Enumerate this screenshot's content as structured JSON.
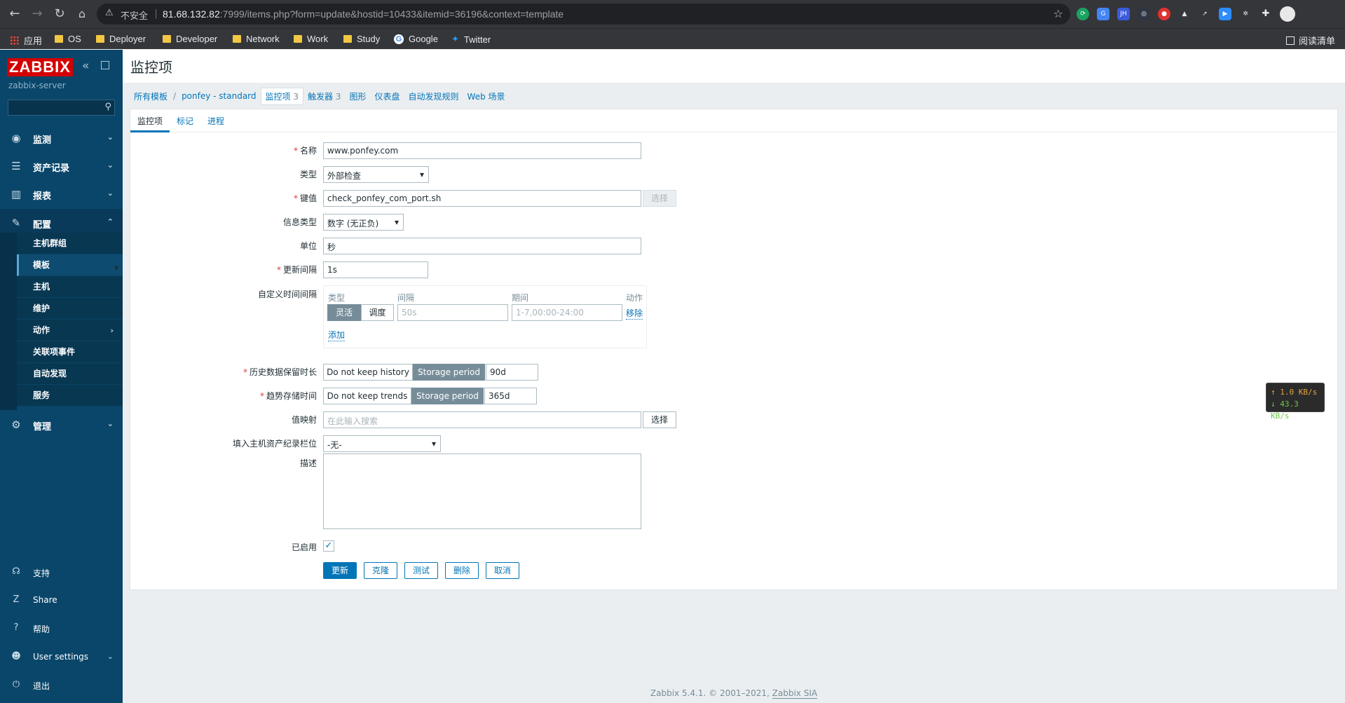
{
  "browser": {
    "security_label": "不安全",
    "url_host": "81.68.132.82",
    "url_rest": ":7999/items.php?form=update&hostid=10433&itemid=36196&context=template",
    "bookmarks": [
      "应用",
      "OS",
      "Deployer",
      "Developer",
      "Network",
      "Work",
      "Study",
      "Google",
      "Twitter"
    ],
    "reading_list": "阅读清单"
  },
  "sidebar": {
    "logo": "ZABBIX",
    "server_name": "zabbix-server",
    "menu": [
      {
        "label": "监测",
        "icon": "eye-icon"
      },
      {
        "label": "资产记录",
        "icon": "list-icon"
      },
      {
        "label": "报表",
        "icon": "chart-icon"
      },
      {
        "label": "配置",
        "icon": "wrench-icon"
      },
      {
        "label": "管理",
        "icon": "gear-icon"
      }
    ],
    "submenu": [
      "主机群组",
      "模板",
      "主机",
      "维护",
      "动作",
      "关联项事件",
      "自动发现",
      "服务"
    ],
    "bottom": [
      {
        "label": "支持",
        "icon": "headset-icon"
      },
      {
        "label": "Share",
        "icon": "share-icon"
      },
      {
        "label": "帮助",
        "icon": "help-icon"
      },
      {
        "label": "User settings",
        "icon": "user-icon"
      },
      {
        "label": "退出",
        "icon": "power-icon"
      }
    ]
  },
  "page": {
    "title": "监控项",
    "breadcrumbs": {
      "all_templates": "所有模板",
      "template": "ponfey - standard",
      "items": "监控项",
      "items_count": "3",
      "triggers": "触发器",
      "triggers_count": "3",
      "graphs": "图形",
      "dashboards": "仪表盘",
      "discovery": "自动发现规则",
      "web": "Web 场景"
    },
    "tabs": [
      "监控项",
      "标记",
      "进程"
    ]
  },
  "form": {
    "name_label": "名称",
    "name_value": "www.ponfey.com",
    "type_label": "类型",
    "type_value": "外部检查",
    "key_label": "键值",
    "key_value": "check_ponfey_com_port.sh",
    "key_select": "选择",
    "info_type_label": "信息类型",
    "info_type_value": "数字 (无正负)",
    "units_label": "单位",
    "units_value": "秒",
    "interval_label": "更新间隔",
    "interval_value": "1s",
    "custom_label": "自定义时间间隔",
    "custom_headers": {
      "type": "类型",
      "interval": "间隔",
      "period": "期间",
      "action": "动作"
    },
    "custom_flexible": "灵活",
    "custom_scheduling": "调度",
    "custom_interval_placeholder": "50s",
    "custom_period_placeholder": "1-7,00:00-24:00",
    "custom_remove": "移除",
    "custom_add": "添加",
    "history_label": "历史数据保留时长",
    "history_off": "Do not keep history",
    "history_on": "Storage period",
    "history_value": "90d",
    "trends_label": "趋势存储时间",
    "trends_off": "Do not keep trends",
    "trends_on": "Storage period",
    "trends_value": "365d",
    "valuemap_label": "值映射",
    "valuemap_placeholder": "在此输入搜索",
    "valuemap_select": "选择",
    "inventory_label": "填入主机资产纪录栏位",
    "inventory_value": "-无-",
    "description_label": "描述",
    "description_value": "",
    "enabled_label": "已启用",
    "enabled": true
  },
  "buttons": {
    "update": "更新",
    "clone": "克隆",
    "test": "测试",
    "delete": "删除",
    "cancel": "取消"
  },
  "footer": {
    "text": "Zabbix 5.4.1. © 2001–2021, ",
    "link": "Zabbix SIA"
  },
  "speed_widget": {
    "up": "↑ 1.0 KB/s",
    "down": "↓ 43.3 KB/s"
  },
  "colors": {
    "sidebar": "#0a466a",
    "accent": "#0275b8",
    "logo": "#d40000"
  }
}
